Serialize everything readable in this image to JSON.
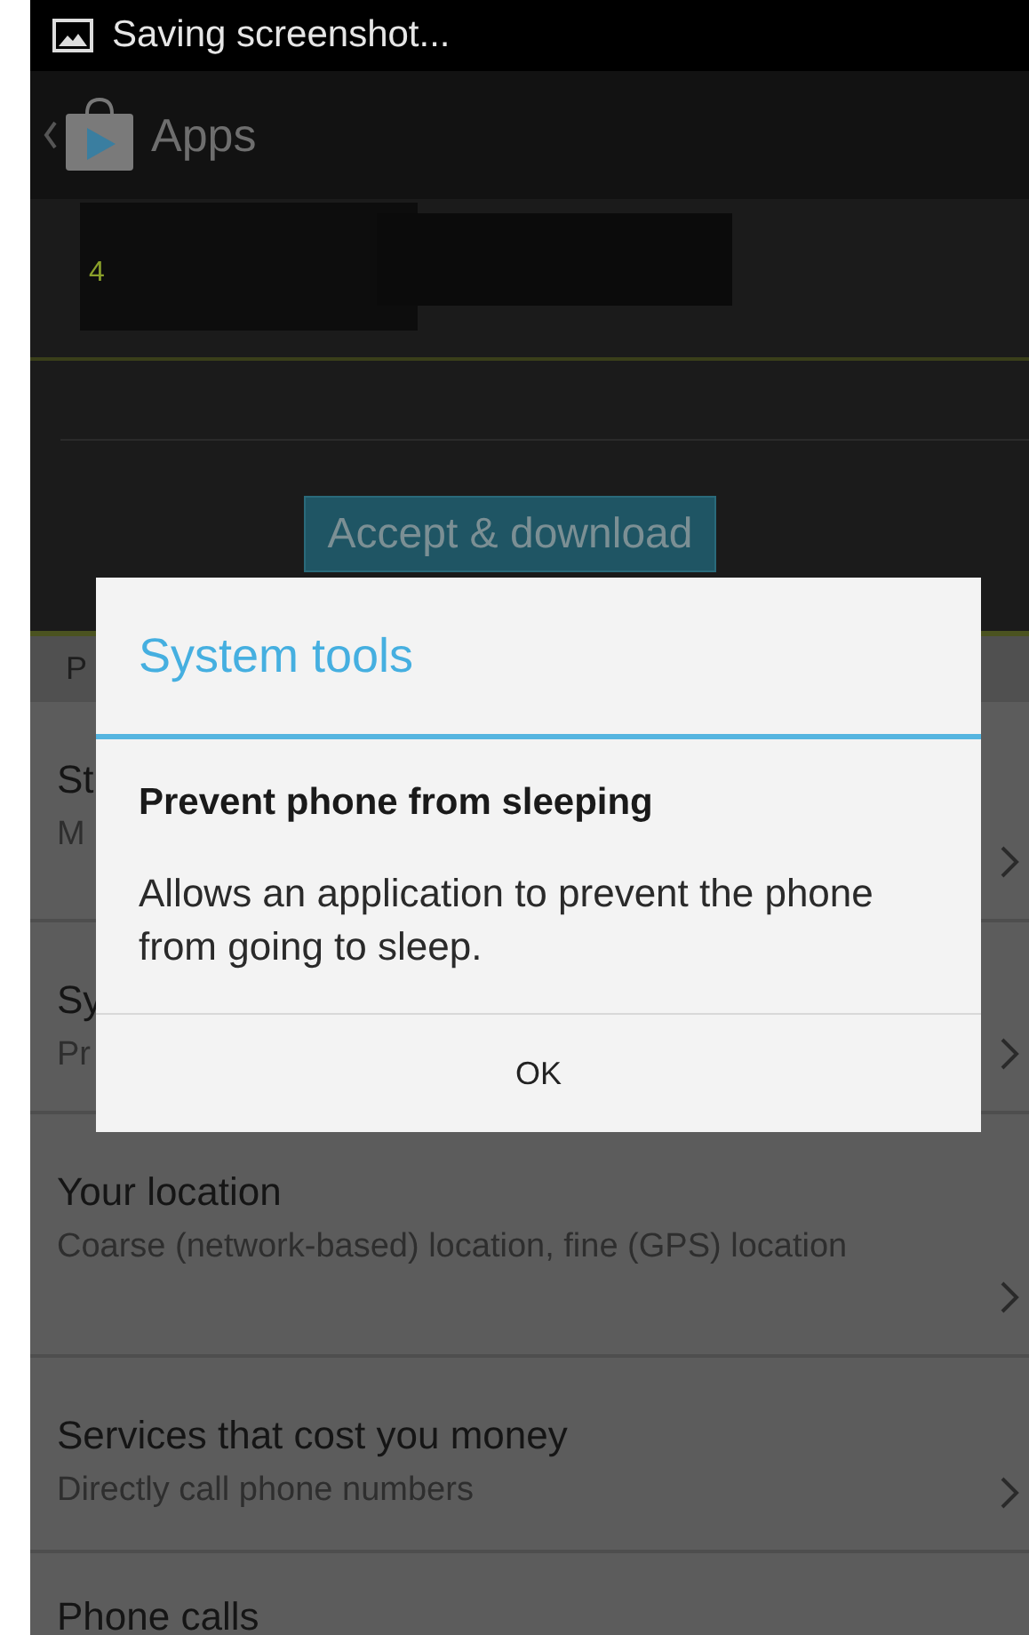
{
  "status_bar": {
    "notification": "Saving screenshot..."
  },
  "action_bar": {
    "title": "Apps"
  },
  "app_header": {
    "text": "4"
  },
  "accept_button": {
    "label": "Accept & download"
  },
  "tab_strip": {
    "label": "P"
  },
  "permissions": [
    {
      "title": "St",
      "subtitle": "M",
      "chevron": true
    },
    {
      "title": "Sy",
      "subtitle": "Pr",
      "chevron": true
    },
    {
      "title": "Your location",
      "subtitle": "Coarse (network-based) location, fine (GPS) location",
      "chevron": true
    },
    {
      "title": "Services that cost you money",
      "subtitle": "Directly call phone numbers",
      "chevron": true
    },
    {
      "title": "Phone calls",
      "chevron": false
    }
  ],
  "dialog": {
    "title": "System tools",
    "permission": "Prevent phone from sleeping",
    "description": "Allows an application to prevent the phone from going to sleep.",
    "button": "OK"
  }
}
